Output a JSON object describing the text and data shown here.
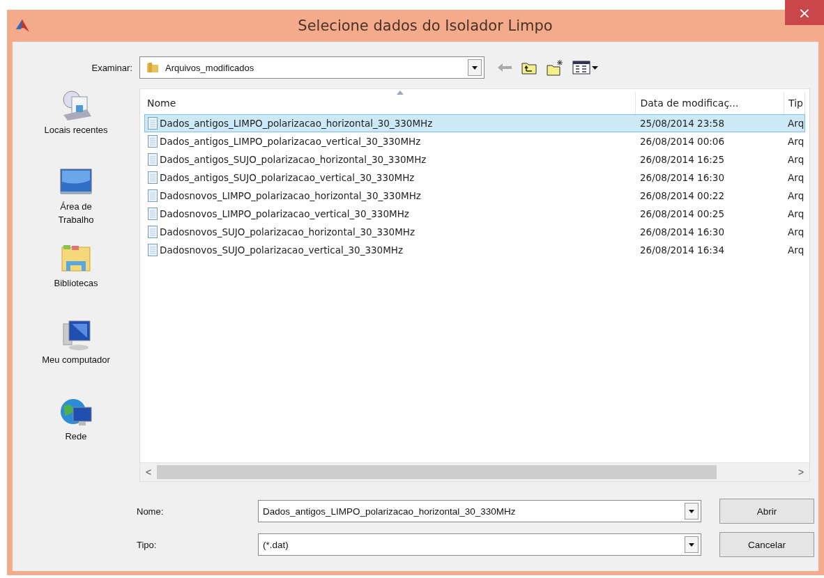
{
  "window": {
    "title": "Selecione dados do Isolador Limpo",
    "close": "×"
  },
  "look_in": {
    "label": "Examinar:",
    "value": "Arquivos_modificados"
  },
  "sidebar": {
    "items": [
      {
        "label": "Locais recentes",
        "kind": "recent"
      },
      {
        "label": "Área de Trabalho",
        "kind": "desktop"
      },
      {
        "label": "Bibliotecas",
        "kind": "libraries"
      },
      {
        "label": "Meu computador",
        "kind": "computer"
      },
      {
        "label": "Rede",
        "kind": "network"
      }
    ]
  },
  "table": {
    "columns": [
      "Nome",
      "Data de modificaç...",
      "Tip"
    ],
    "rows": [
      {
        "name": "Dados_antigos_LIMPO_polarizacao_horizontal_30_330MHz",
        "date": "25/08/2014 23:58",
        "type": "Arq",
        "selected": true
      },
      {
        "name": "Dados_antigos_LIMPO_polarizacao_vertical_30_330MHz",
        "date": "26/08/2014 00:06",
        "type": "Arq",
        "selected": false
      },
      {
        "name": "Dados_antigos_SUJO_polarizacao_horizontal_30_330MHz",
        "date": "26/08/2014 16:25",
        "type": "Arq",
        "selected": false
      },
      {
        "name": "Dados_antigos_SUJO_polarizacao_vertical_30_330MHz",
        "date": "26/08/2014 16:30",
        "type": "Arq",
        "selected": false
      },
      {
        "name": "Dadosnovos_LIMPO_polarizacao_horizontal_30_330MHz",
        "date": "26/08/2014 00:22",
        "type": "Arq",
        "selected": false
      },
      {
        "name": "Dadosnovos_LIMPO_polarizacao_vertical_30_330MHz",
        "date": "26/08/2014 00:25",
        "type": "Arq",
        "selected": false
      },
      {
        "name": "Dadosnovos_SUJO_polarizacao_horizontal_30_330MHz",
        "date": "26/08/2014 16:30",
        "type": "Arq",
        "selected": false
      },
      {
        "name": "Dadosnovos_SUJO_polarizacao_vertical_30_330MHz",
        "date": "26/08/2014 16:34",
        "type": "Arq",
        "selected": false
      }
    ]
  },
  "scrollbar": {
    "left": "<",
    "right": ">"
  },
  "fields": [
    {
      "label": "Nome:",
      "value": "Dados_antigos_LIMPO_polarizacao_horizontal_30_330MHz",
      "button": "Abrir"
    },
    {
      "label": "Tipo:",
      "value": "(*.dat)",
      "button": "Cancelar"
    }
  ]
}
